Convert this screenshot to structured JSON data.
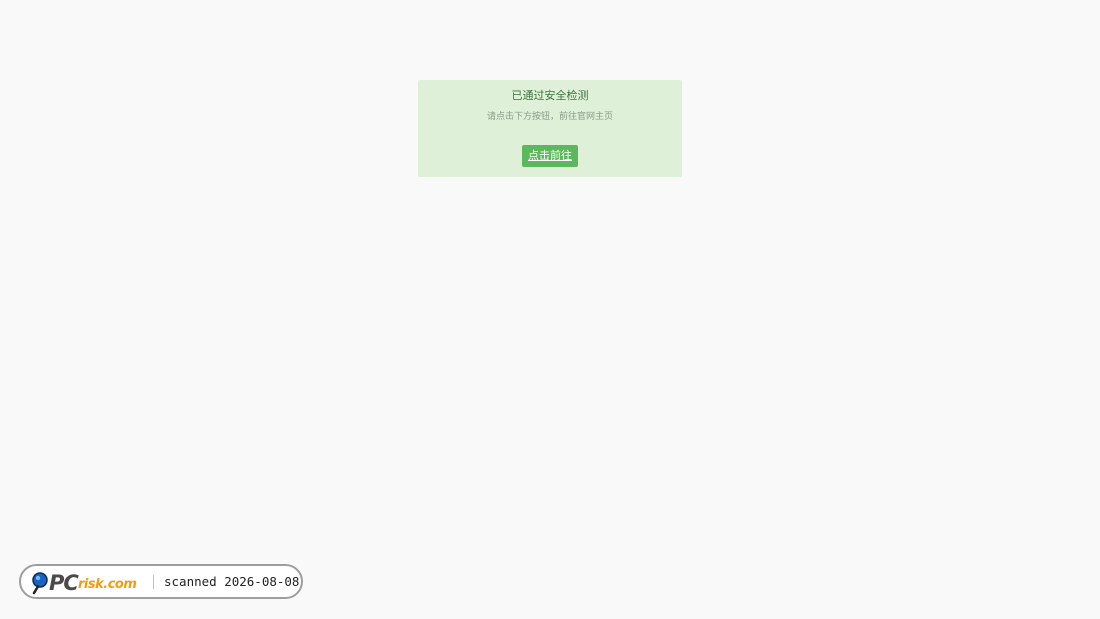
{
  "notice": {
    "title": "已通过安全检测",
    "subtitle": "请点击下方按钮，前往官网主页",
    "button_label": "点击前往"
  },
  "badge": {
    "logo_text_main": "PC",
    "logo_text_suffix": "risk.com",
    "scan_text": "scanned 2026-08-08"
  },
  "colors": {
    "page_background": "#f9f9f9",
    "notice_background": "#dff0d8",
    "title_color": "#3c763d",
    "button_background": "#5cb85c",
    "logo_orange": "#f39c12",
    "logo_blue": "#1565c0"
  }
}
